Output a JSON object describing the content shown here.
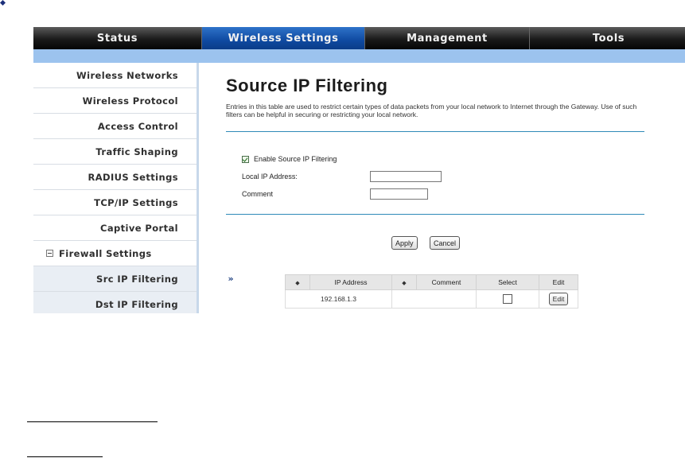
{
  "nav": {
    "tabs": [
      {
        "label": "Status",
        "active": false
      },
      {
        "label": "Wireless Settings",
        "active": true
      },
      {
        "label": "Management",
        "active": false
      },
      {
        "label": "Tools",
        "active": false
      }
    ]
  },
  "sidebar": {
    "items": [
      {
        "label": "Wireless Networks"
      },
      {
        "label": "Wireless Protocol"
      },
      {
        "label": "Access Control"
      },
      {
        "label": "Traffic Shaping"
      },
      {
        "label": "RADIUS Settings"
      },
      {
        "label": "TCP/IP Settings"
      },
      {
        "label": "Captive Portal"
      },
      {
        "label": "Firewall Settings"
      },
      {
        "label": "Src IP Filtering"
      },
      {
        "label": "Dst IP Filtering"
      }
    ],
    "current_marker": "»"
  },
  "main": {
    "title": "Source IP Filtering",
    "description": "Entries in this table are used to restrict certain types of data packets from your local network to Internet through the Gateway. Use of such filters can be helpful in securing or restricting your local network.",
    "enable_label": "Enable Source IP Filtering",
    "enable_checked": true,
    "local_ip_label": "Local IP Address:",
    "local_ip_value": "",
    "comment_label": "Comment",
    "comment_value": "",
    "apply_label": "Apply",
    "cancel_label": "Cancel"
  },
  "table": {
    "headers": [
      "IP Address",
      "Comment",
      "Select",
      "Edit"
    ],
    "sort_marker": "◆",
    "rows": [
      {
        "ip": "192.168.1.3",
        "comment": "",
        "selected": false,
        "edit_label": "Edit"
      }
    ]
  },
  "colors": {
    "nav_dark": "#111111",
    "nav_active": "#1a56b0",
    "subbar": "#9cc3ee",
    "rule": "#2f8ab8"
  }
}
